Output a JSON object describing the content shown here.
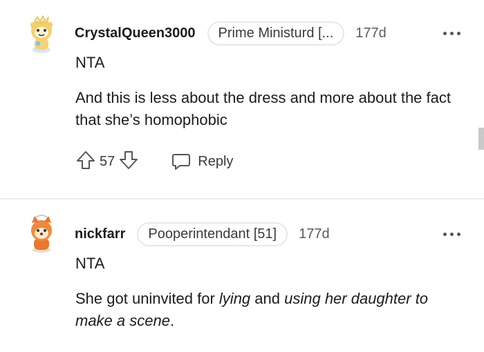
{
  "comments": [
    {
      "username": "CrystalQueen3000",
      "flair": "Prime Ministurd [...",
      "age": "177d",
      "avatar_icon": "snoo-avatar-crown-icon",
      "line1": "NTA",
      "body": "And this is less about the dress and more about the fact that she’s homophobic",
      "score": "57",
      "reply_label": "Reply"
    },
    {
      "username": "nickfarr",
      "flair": "Pooperintendant [51]",
      "age": "177d",
      "avatar_icon": "snoo-avatar-fox-icon",
      "line1": "NTA",
      "body_parts": [
        "She got uninvited for ",
        "lying",
        " and ",
        "using her daughter to make a scene",
        "."
      ]
    }
  ],
  "colors": {
    "text": "#1c1c1c",
    "meta": "#5a5a5a",
    "divider": "#ededed",
    "flair_border": "#e8e8e8"
  }
}
